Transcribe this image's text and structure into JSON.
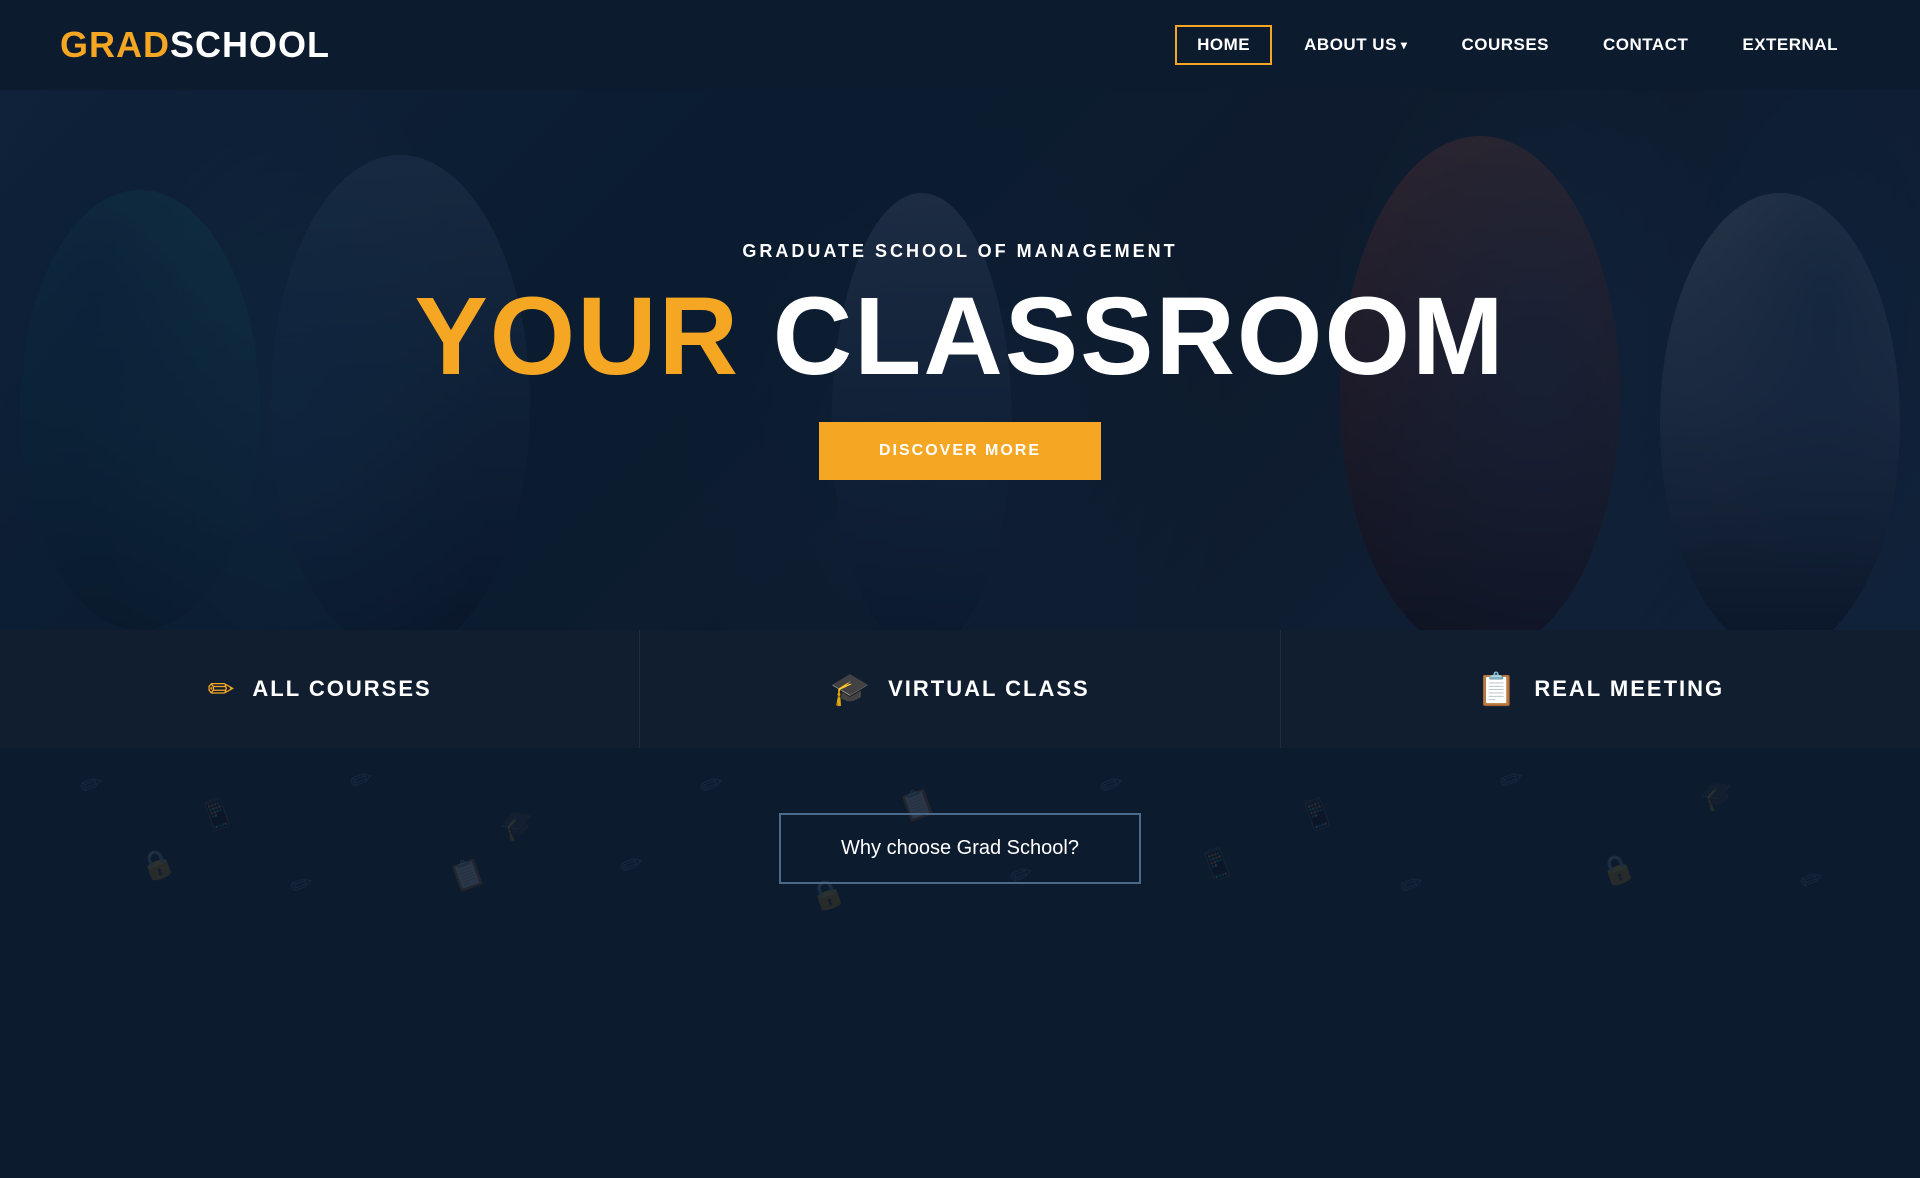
{
  "logo": {
    "grad": "GRAD",
    "school": " SCHOOL"
  },
  "nav": {
    "items": [
      {
        "id": "home",
        "label": "HOME",
        "active": true
      },
      {
        "id": "about",
        "label": "ABOUT US",
        "dropdown": true
      },
      {
        "id": "courses",
        "label": "COURSES",
        "dropdown": false
      },
      {
        "id": "contact",
        "label": "CONTACT",
        "dropdown": false
      },
      {
        "id": "external",
        "label": "EXTERNAL",
        "dropdown": false
      }
    ]
  },
  "hero": {
    "subtitle": "GRADUATE SCHOOL OF MANAGEMENT",
    "title_your": "YOUR",
    "title_classroom": " CLASSROOM",
    "cta_button": "DISCOVER MORE"
  },
  "feature_cards": [
    {
      "id": "all-courses",
      "icon": "✏",
      "label": "ALL COURSES"
    },
    {
      "id": "virtual-class",
      "icon": "🎓",
      "label": "VIRTUAL CLASS"
    },
    {
      "id": "real-meeting",
      "icon": "📋",
      "label": "REAL MEETING"
    }
  ],
  "bottom": {
    "why_choose_label": "Why choose Grad School?"
  },
  "colors": {
    "accent": "#f5a623",
    "bg_dark": "#0d1b2e",
    "bg_card": "#111e30",
    "text_white": "#ffffff"
  }
}
